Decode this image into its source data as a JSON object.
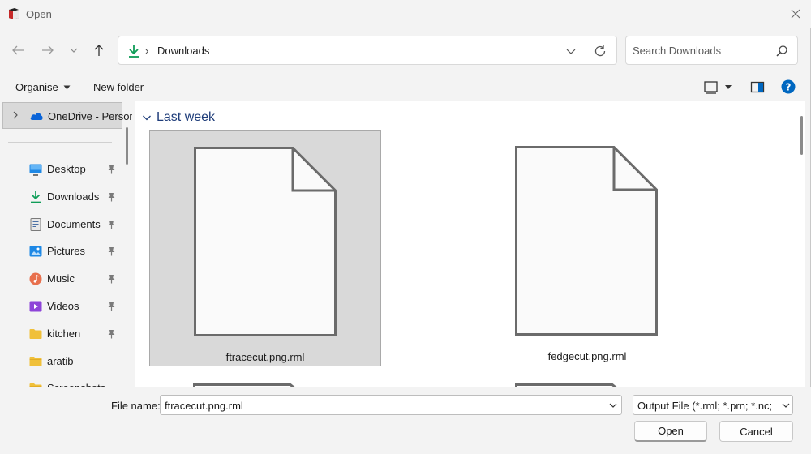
{
  "window": {
    "title": "Open"
  },
  "address": {
    "location": "Downloads",
    "separator": "›"
  },
  "search": {
    "placeholder": "Search Downloads"
  },
  "commands": {
    "organise": "Organise",
    "new_folder": "New folder"
  },
  "navigation": {
    "onedrive": "OneDrive - Personal",
    "items": [
      {
        "label": "Desktop",
        "icon": "desktop-icon",
        "pinned": true
      },
      {
        "label": "Downloads",
        "icon": "download-icon",
        "pinned": true
      },
      {
        "label": "Documents",
        "icon": "documents-icon",
        "pinned": true
      },
      {
        "label": "Pictures",
        "icon": "pictures-icon",
        "pinned": true
      },
      {
        "label": "Music",
        "icon": "music-icon",
        "pinned": true
      },
      {
        "label": "Videos",
        "icon": "videos-icon",
        "pinned": true
      },
      {
        "label": "kitchen",
        "icon": "folder-icon",
        "pinned": true
      },
      {
        "label": "aratib",
        "icon": "folder-icon",
        "pinned": false
      },
      {
        "label": "Screenshots",
        "icon": "folder-icon",
        "pinned": false
      }
    ]
  },
  "content": {
    "group": "Last week",
    "files": [
      {
        "name": "ftracecut.png.rml",
        "selected": true
      },
      {
        "name": "fedgecut.png.rml",
        "selected": false
      }
    ]
  },
  "footer": {
    "file_name_label": "File name:",
    "file_name_value": "ftracecut.png.rml",
    "filter": "Output File (*.rml; *.prn; *.nc; *.",
    "open": "Open",
    "cancel": "Cancel"
  },
  "colors": {
    "accent": "#0067c0",
    "header": "#1f3d7a",
    "selected_tile": "#d9d9d9"
  }
}
